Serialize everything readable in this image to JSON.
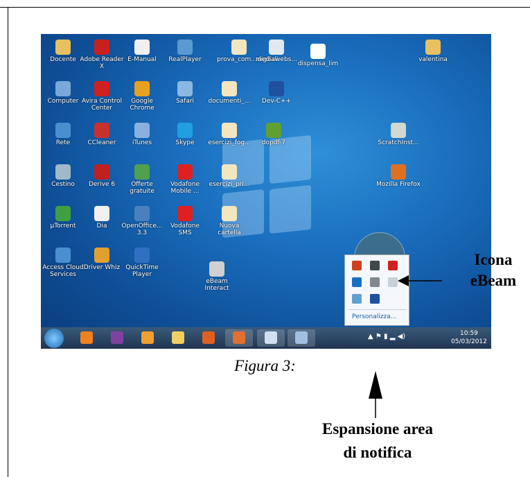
{
  "desktop_icons": [
    {
      "label": "Docente",
      "color": "#e8c060"
    },
    {
      "label": "Adobe Reader X",
      "color": "#c8201e"
    },
    {
      "label": "E-Manual",
      "color": "#f0f0f0"
    },
    {
      "label": "RealPlayer",
      "color": "#5a9ad0"
    },
    {
      "label": "prova_com...digitali",
      "color": "#f2e6c0"
    },
    {
      "label": "mediawebs...",
      "color": "#e0e8f0"
    },
    {
      "label": "dispensa_lim",
      "color": "#ffffff"
    },
    {
      "label": "valentina",
      "color": "#e8c060"
    },
    {
      "label": "Computer",
      "color": "#7aa8d8"
    },
    {
      "label": "Avira Control Center",
      "color": "#d02020"
    },
    {
      "label": "Google Chrome",
      "color": "#e8a020"
    },
    {
      "label": "Safari",
      "color": "#8ab8e0"
    },
    {
      "label": "documenti_...",
      "color": "#f2e6c0"
    },
    {
      "label": "Dev-C++",
      "color": "#2050a0"
    },
    {
      "label": "Rete",
      "color": "#4a90d0"
    },
    {
      "label": "CCleaner",
      "color": "#c83030"
    },
    {
      "label": "iTunes",
      "color": "#8ab0e0"
    },
    {
      "label": "Skype",
      "color": "#20a0e0"
    },
    {
      "label": "esercizi_fog...",
      "color": "#f2e6c0"
    },
    {
      "label": "dopdf-7",
      "color": "#60a030"
    },
    {
      "label": "ScratchInst...",
      "color": "#d0d8d0"
    },
    {
      "label": "Cestino",
      "color": "#a0b8c8"
    },
    {
      "label": "Derive 6",
      "color": "#c02020"
    },
    {
      "label": "Offerte gratuite",
      "color": "#50a050"
    },
    {
      "label": "Vodafone Mobile ...",
      "color": "#e02020"
    },
    {
      "label": "esercizi_pri...",
      "color": "#f2e6c0"
    },
    {
      "label": "Mozilla Firefox",
      "color": "#e07020"
    },
    {
      "label": "µTorrent",
      "color": "#40a040"
    },
    {
      "label": "Dia",
      "color": "#f0f0f0"
    },
    {
      "label": "OpenOffice... 3.3",
      "color": "#4a80c0"
    },
    {
      "label": "Vodafone SMS",
      "color": "#e02020"
    },
    {
      "label": "Nuova cartella",
      "color": "#f2e6c0"
    },
    {
      "label": "Access Cloud Services",
      "color": "#4a90d0"
    },
    {
      "label": "Driver Whiz",
      "color": "#e0a030"
    },
    {
      "label": "QuickTime Player",
      "color": "#3070c0"
    },
    {
      "label": "eBeam Interact",
      "color": "#d0d0d0"
    }
  ],
  "taskbar": {
    "time": "10:59",
    "date": "05/03/2012",
    "apps": [
      {
        "name": "vlc",
        "color": "#f08020"
      },
      {
        "name": "winrar",
        "color": "#8040a0"
      },
      {
        "name": "scratch",
        "color": "#f0a030"
      },
      {
        "name": "explorer",
        "color": "#f0d060"
      },
      {
        "name": "firefox",
        "color": "#e06020"
      },
      {
        "name": "firefox-active",
        "color": "#e07030"
      },
      {
        "name": "document",
        "color": "#d0e0f0"
      },
      {
        "name": "paint",
        "color": "#a0c0e0"
      }
    ]
  },
  "tray_popup": {
    "customize": "Personalizza...",
    "icons": [
      {
        "name": "volume-icon",
        "color": "#d04020"
      },
      {
        "name": "network-icon",
        "color": "#404850"
      },
      {
        "name": "avira-icon",
        "color": "#d02020"
      },
      {
        "name": "skype-icon",
        "color": "#1a70c0"
      },
      {
        "name": "ebeam-icon",
        "color": "#808890"
      },
      {
        "name": "blank-icon",
        "color": "#c8d0d8"
      },
      {
        "name": "security-icon",
        "color": "#60a0d0"
      },
      {
        "name": "monitor-icon",
        "color": "#2050a0"
      }
    ]
  },
  "caption": "Figura 3:",
  "callout_right": {
    "line1": "Icona",
    "line2": "eBeam"
  },
  "callout_bottom": {
    "line1": "Espansione area",
    "line2": "di notifica"
  }
}
